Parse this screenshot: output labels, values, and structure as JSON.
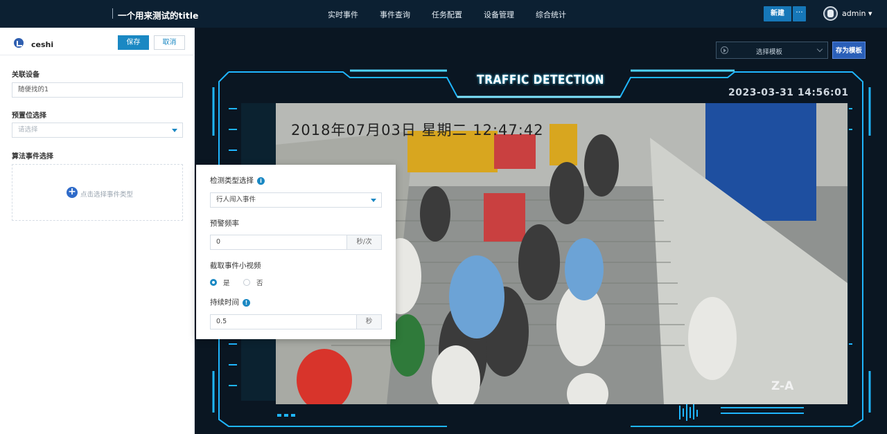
{
  "header": {
    "title": "一个用来测试的title",
    "nav": [
      "实时事件",
      "事件查询",
      "任务配置",
      "设备管理",
      "综合统计"
    ],
    "new_button": "新建",
    "more_button": "···",
    "user": "admin ▾"
  },
  "left_panel": {
    "title": "ceshi",
    "save": "保存",
    "cancel": "取消",
    "device_label": "关联设备",
    "device_value": "随便找的1",
    "preset_label": "预置位选择",
    "preset_placeholder": "请选择",
    "algo_label": "算法事件选择",
    "algo_hint": "点击选择事件类型"
  },
  "toolbar": {
    "template_placeholder": "选择模板",
    "save_template": "存为模板"
  },
  "video": {
    "title": "TRAFFIC DETECTION",
    "timestamp": "2023-03-31 14:56:01",
    "overlay_text": "2018年07月03日 星期二 12:47:42",
    "camera_label": "Z-A"
  },
  "popup": {
    "detect_type_label": "检测类型选择",
    "detect_type_value": "行人闯入事件",
    "alarm_freq_label": "预警频率",
    "alarm_freq_value": "0",
    "alarm_freq_unit": "秒/次",
    "clip_label": "截取事件小视频",
    "clip_yes": "是",
    "clip_no": "否",
    "clip_selected": "是",
    "duration_label": "持续时间",
    "duration_value": "0.5",
    "duration_unit": "秒"
  },
  "colors": {
    "accent": "#1a88c3",
    "nav_bg": "#0c2032",
    "frame_cyan": "#1fb6ff"
  }
}
